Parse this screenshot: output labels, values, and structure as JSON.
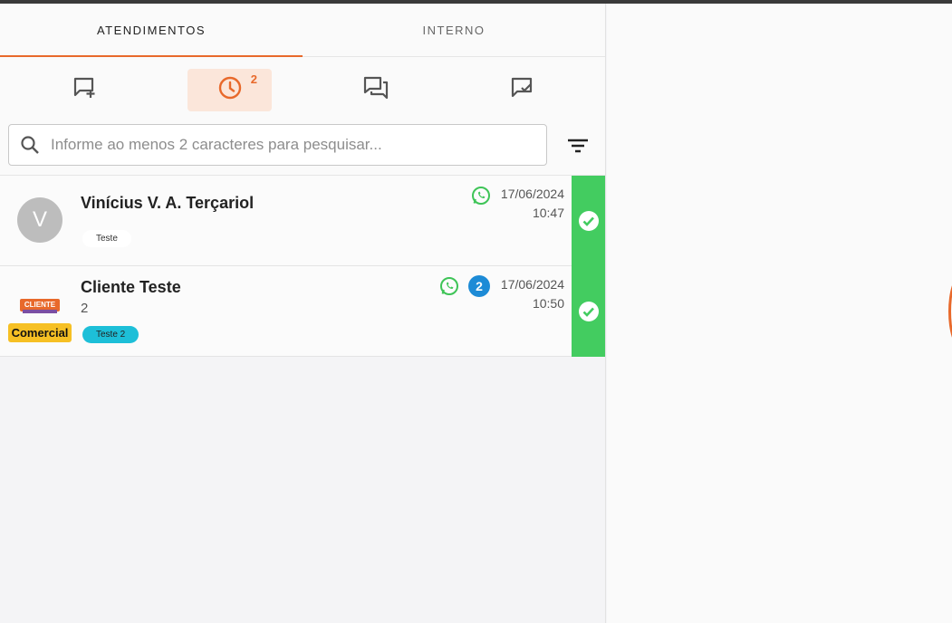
{
  "tabs": [
    {
      "label": "ATENDIMENTOS",
      "active": true
    },
    {
      "label": "INTERNO",
      "active": false
    }
  ],
  "filters": {
    "new_icon": "chat-add-icon",
    "waiting_icon": "clock-icon",
    "waiting_count": "2",
    "open_icon": "forum-icon",
    "done_icon": "chat-check-icon"
  },
  "search": {
    "placeholder": "Informe ao menos 2 caracteres para pesquisar...",
    "value": ""
  },
  "conversations": [
    {
      "avatar_letter": "V",
      "name": "Vinícius V. A. Terçariol",
      "channel_icon": "whatsapp-icon",
      "date": "17/06/2024",
      "time": "10:47",
      "tag": "Teste",
      "tag_color": "#ffffff"
    },
    {
      "logo_text": "CLIENTE",
      "department": "Comercial",
      "name": "Cliente Teste",
      "preview": "2",
      "channel_icon": "whatsapp-icon",
      "unread": "2",
      "date": "17/06/2024",
      "time": "10:50",
      "tag": "Teste 2",
      "tag_color": "#1dbfd8"
    }
  ],
  "colors": {
    "accent": "#e8692b",
    "finish": "#43cc60",
    "unread_badge": "#1d8bd6",
    "whatsapp": "#3ec457",
    "department": "#f6c024"
  }
}
